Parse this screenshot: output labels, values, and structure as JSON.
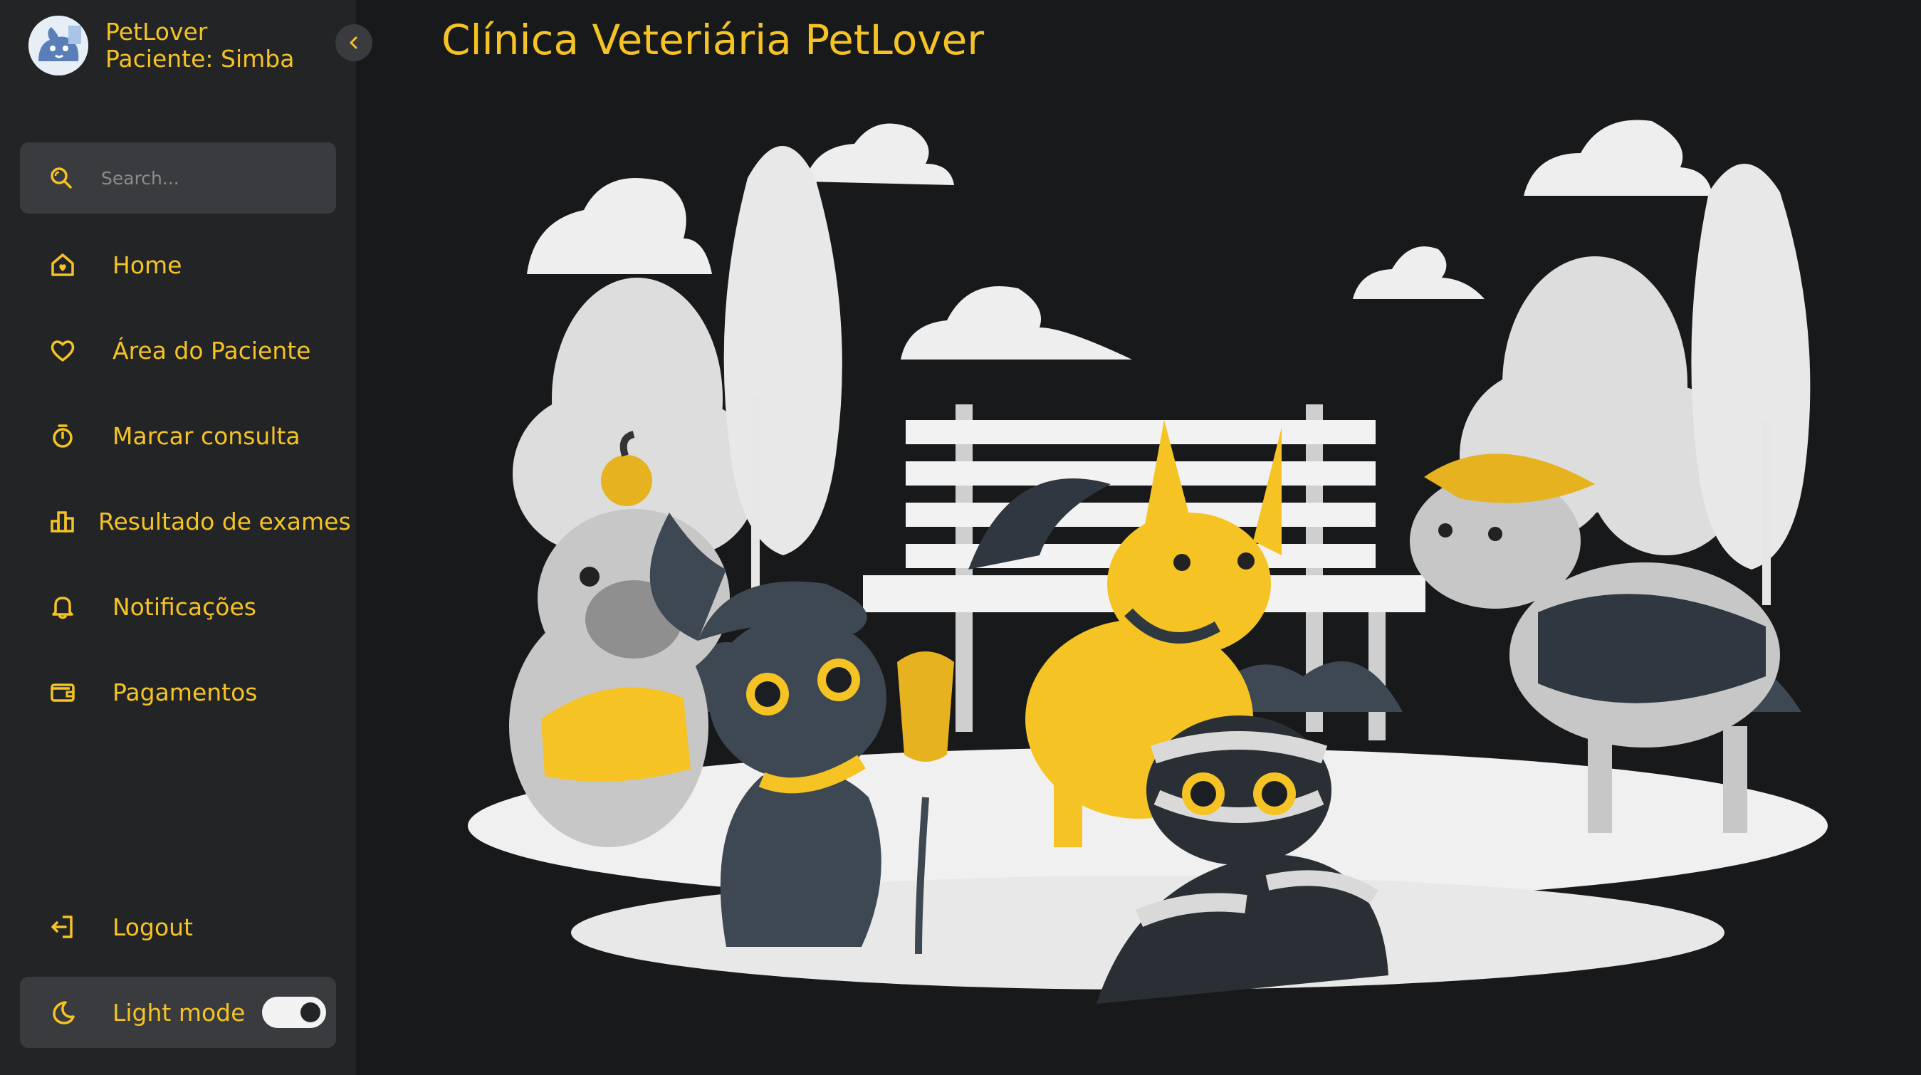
{
  "sidebar": {
    "brand_name": "PetLover",
    "patient": "Paciente: Simba",
    "search_placeholder": "Search...",
    "items": [
      {
        "label": "Home",
        "icon": "home-icon"
      },
      {
        "label": "Área do Paciente",
        "icon": "heart-icon"
      },
      {
        "label": "Marcar consulta",
        "icon": "timer-icon"
      },
      {
        "label": "Resultado de exames",
        "icon": "bar-chart-icon"
      },
      {
        "label": "Notificações",
        "icon": "bell-icon"
      },
      {
        "label": "Pagamentos",
        "icon": "wallet-icon"
      }
    ],
    "logout_label": "Logout",
    "mode_label": "Light mode"
  },
  "main": {
    "title": "Clínica Veteriária PetLover"
  },
  "colors": {
    "accent": "#f5c324",
    "background": "#18191b",
    "sidebar": "#232426"
  }
}
